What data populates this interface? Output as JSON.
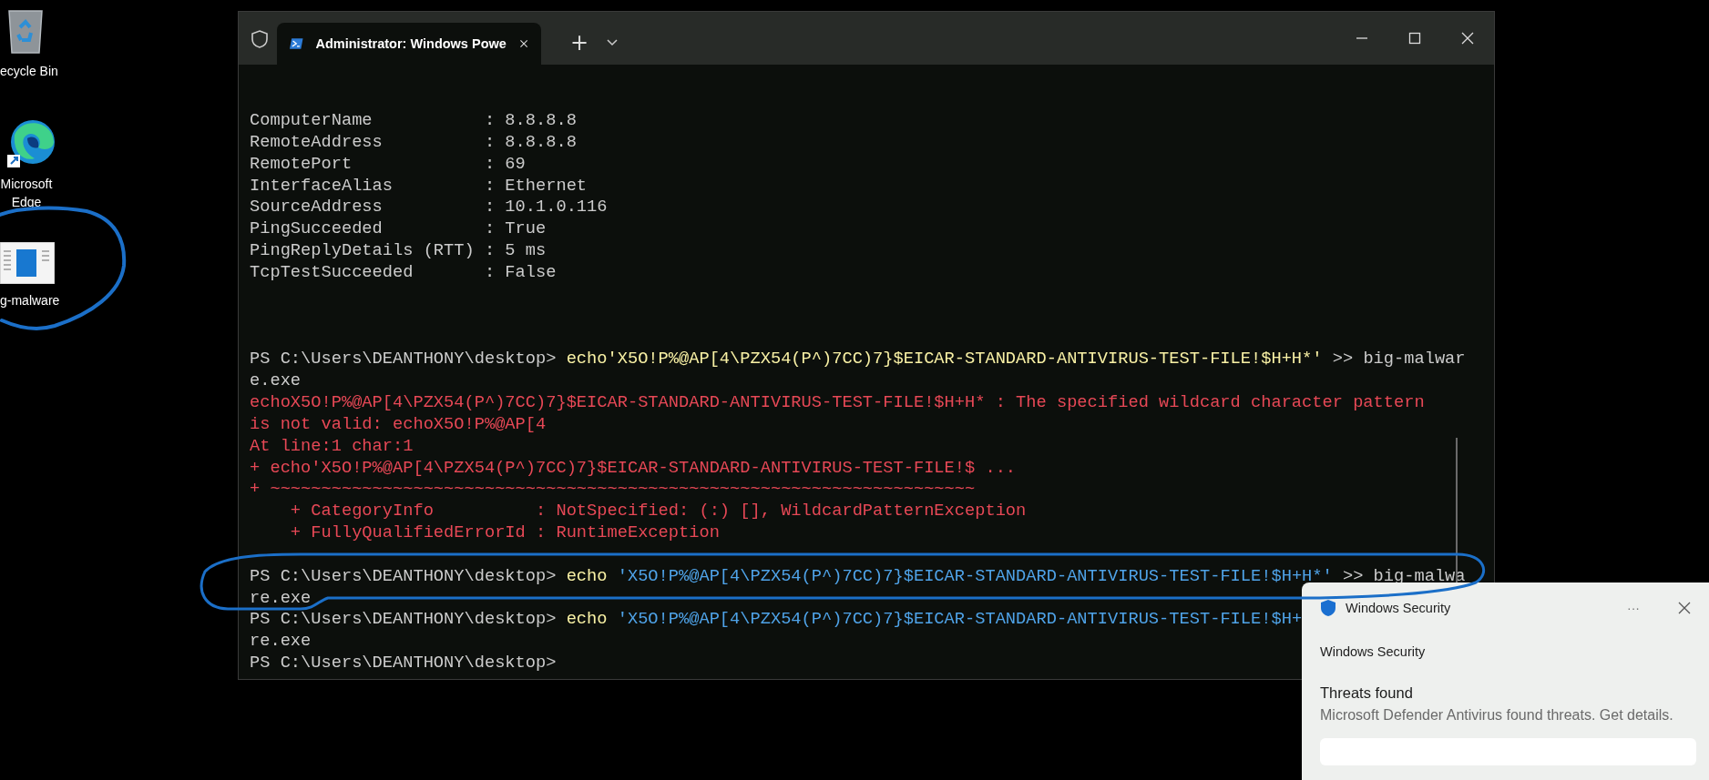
{
  "desktop_icons": [
    {
      "kind": "recycle-bin",
      "label": "ecycle Bin"
    },
    {
      "kind": "edge",
      "label": "Microsoft Edge"
    },
    {
      "kind": "document",
      "label": "g-malware"
    }
  ],
  "terminal": {
    "tab": {
      "title": "Administrator: Windows Powe",
      "selected": true
    },
    "new_tab": "+",
    "lines": [
      {
        "kind": "output",
        "segments": [
          {
            "kind": "plain",
            "text": "ComputerName           : 8.8.8.8"
          }
        ]
      },
      {
        "kind": "output",
        "segments": [
          {
            "kind": "plain",
            "text": "RemoteAddress          : 8.8.8.8"
          }
        ]
      },
      {
        "kind": "output",
        "segments": [
          {
            "kind": "plain",
            "text": "RemotePort             : 69"
          }
        ]
      },
      {
        "kind": "output",
        "segments": [
          {
            "kind": "plain",
            "text": "InterfaceAlias         : Ethernet"
          }
        ]
      },
      {
        "kind": "output",
        "segments": [
          {
            "kind": "plain",
            "text": "SourceAddress          : 10.1.0.116"
          }
        ]
      },
      {
        "kind": "output",
        "segments": [
          {
            "kind": "plain",
            "text": "PingSucceeded          : True"
          }
        ]
      },
      {
        "kind": "output",
        "segments": [
          {
            "kind": "plain",
            "text": "PingReplyDetails (RTT) : 5 ms"
          }
        ]
      },
      {
        "kind": "output",
        "segments": [
          {
            "kind": "plain",
            "text": "TcpTestSucceeded       : False"
          }
        ]
      },
      {
        "kind": "blank"
      },
      {
        "kind": "blank"
      },
      {
        "kind": "blank"
      },
      {
        "kind": "prompt",
        "segments": [
          {
            "kind": "plain",
            "text": "PS C:\\Users\\DEANTHONY\\desktop> "
          },
          {
            "kind": "command",
            "text": "echo'X5O!P%@AP[4\\PZX54(P^)7CC)7}$EICAR-STANDARD-ANTIVIRUS-TEST-FILE!$H+H*'"
          },
          {
            "kind": "plain",
            "text": " >> big-malwar"
          }
        ]
      },
      {
        "kind": "prompt",
        "segments": [
          {
            "kind": "plain",
            "text": "e.exe"
          }
        ]
      },
      {
        "kind": "error",
        "segments": [
          {
            "kind": "error",
            "text": "echoX5O!P%@AP[4\\PZX54(P^)7CC)7}$EICAR-STANDARD-ANTIVIRUS-TEST-FILE!$H+H* : The specified wildcard character pattern"
          }
        ]
      },
      {
        "kind": "error",
        "segments": [
          {
            "kind": "error",
            "text": "is not valid: echoX5O!P%@AP[4"
          }
        ]
      },
      {
        "kind": "error",
        "segments": [
          {
            "kind": "error",
            "text": "At line:1 char:1"
          }
        ]
      },
      {
        "kind": "error",
        "segments": [
          {
            "kind": "error",
            "text": "+ echo'X5O!P%@AP[4\\PZX54(P^)7CC)7}$EICAR-STANDARD-ANTIVIRUS-TEST-FILE!$ ..."
          }
        ]
      },
      {
        "kind": "error",
        "segments": [
          {
            "kind": "error",
            "text": "+ ~~~~~~~~~~~~~~~~~~~~~~~~~~~~~~~~~~~~~~~~~~~~~~~~~~~~~~~~~~~~~~~~~~~~~"
          }
        ]
      },
      {
        "kind": "error",
        "segments": [
          {
            "kind": "error",
            "text": "    + CategoryInfo          : NotSpecified: (:) [], WildcardPatternException"
          }
        ]
      },
      {
        "kind": "error",
        "segments": [
          {
            "kind": "error",
            "text": "    + FullyQualifiedErrorId : RuntimeException"
          }
        ]
      },
      {
        "kind": "blank"
      },
      {
        "kind": "prompt",
        "segments": [
          {
            "kind": "plain",
            "text": "PS C:\\Users\\DEANTHONY\\desktop> "
          },
          {
            "kind": "command",
            "text": "echo"
          },
          {
            "kind": "string",
            "text": " 'X5O!P%@AP[4\\PZX54(P^)7CC)7}$EICAR-STANDARD-ANTIVIRUS-TEST-FILE!$H+H*'"
          },
          {
            "kind": "plain",
            "text": " >> big-malwa"
          }
        ]
      },
      {
        "kind": "prompt",
        "segments": [
          {
            "kind": "plain",
            "text": "re.exe"
          }
        ]
      },
      {
        "kind": "prompt",
        "segments": [
          {
            "kind": "plain",
            "text": "PS C:\\Users\\DEANTHONY\\desktop> "
          },
          {
            "kind": "command",
            "text": "echo"
          },
          {
            "kind": "string",
            "text": " 'X5O!P%@AP[4\\PZX54(P^)7CC)7}$EICAR-STANDARD-ANTIVIRUS-TEST-FILE!$H+"
          }
        ]
      },
      {
        "kind": "prompt",
        "segments": [
          {
            "kind": "plain",
            "text": "re.exe"
          }
        ]
      },
      {
        "kind": "prompt",
        "segments": [
          {
            "kind": "plain",
            "text": "PS C:\\Users\\DEANTHONY\\desktop>"
          }
        ]
      }
    ]
  },
  "notification": {
    "app": "Windows Security",
    "more": "···",
    "source": "Windows Security",
    "title": "Threats found",
    "message": "Microsoft Defender Antivirus found threats. Get details."
  }
}
